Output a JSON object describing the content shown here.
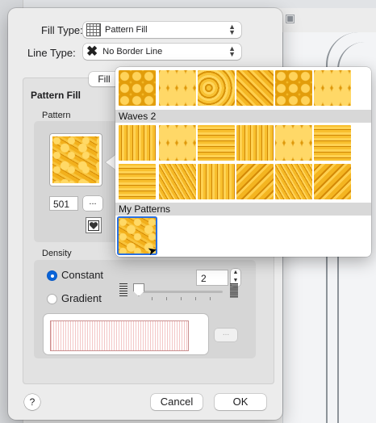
{
  "dialog": {
    "fill_type_label": "Fill Type:",
    "fill_type_value": "Pattern Fill",
    "line_type_label": "Line Type:",
    "line_type_value": "No Border Line",
    "tab_fill": "Fill",
    "section_title": "Pattern Fill",
    "pattern_group_label": "Pattern",
    "pattern_number": "501",
    "pattern_browse": "...",
    "density_label": "Density",
    "density_constant": "Constant",
    "density_gradient": "Gradient",
    "density_value": "2",
    "density_selected": "Constant",
    "density_browse": "...",
    "help": "?",
    "cancel": "Cancel",
    "ok": "OK"
  },
  "popover": {
    "section_waves": "Waves 2",
    "section_my": "My Patterns"
  },
  "colors": {
    "accent": "#0a64d8",
    "pattern_gold": "#f2b21e"
  },
  "icons": {
    "help": "help-icon",
    "heart": "heart-icon",
    "stepper": "stepper-icon"
  }
}
